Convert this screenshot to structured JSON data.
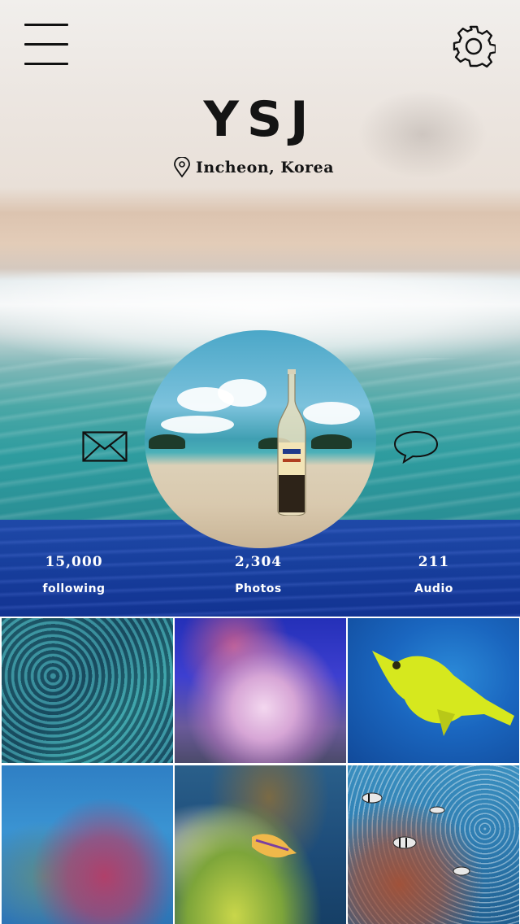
{
  "header": {
    "menu_icon": "hamburger-menu-icon",
    "settings_icon": "gear-icon"
  },
  "profile": {
    "name": "YSJ",
    "location": "Incheon, Korea",
    "location_icon": "map-pin-icon",
    "avatar_desc": "",
    "message_icon": "envelope-icon",
    "chat_icon": "speech-bubble-icon"
  },
  "stats": [
    {
      "value": "15,000",
      "label": "following"
    },
    {
      "value": "2,304",
      "label": "Photos"
    },
    {
      "value": "211",
      "label": "Audio"
    }
  ],
  "colors": {
    "stats_bar": "#173e9c",
    "text_dark": "#141414",
    "text_light": "#ffffff"
  },
  "gallery": {
    "items": [
      {
        "name": "anemone-clownfish"
      },
      {
        "name": "pink-anemone-aquarium"
      },
      {
        "name": "yellow-cowfish"
      },
      {
        "name": "coral-reef-fish"
      },
      {
        "name": "goby-on-coral"
      },
      {
        "name": "reef-fish-school"
      }
    ]
  }
}
